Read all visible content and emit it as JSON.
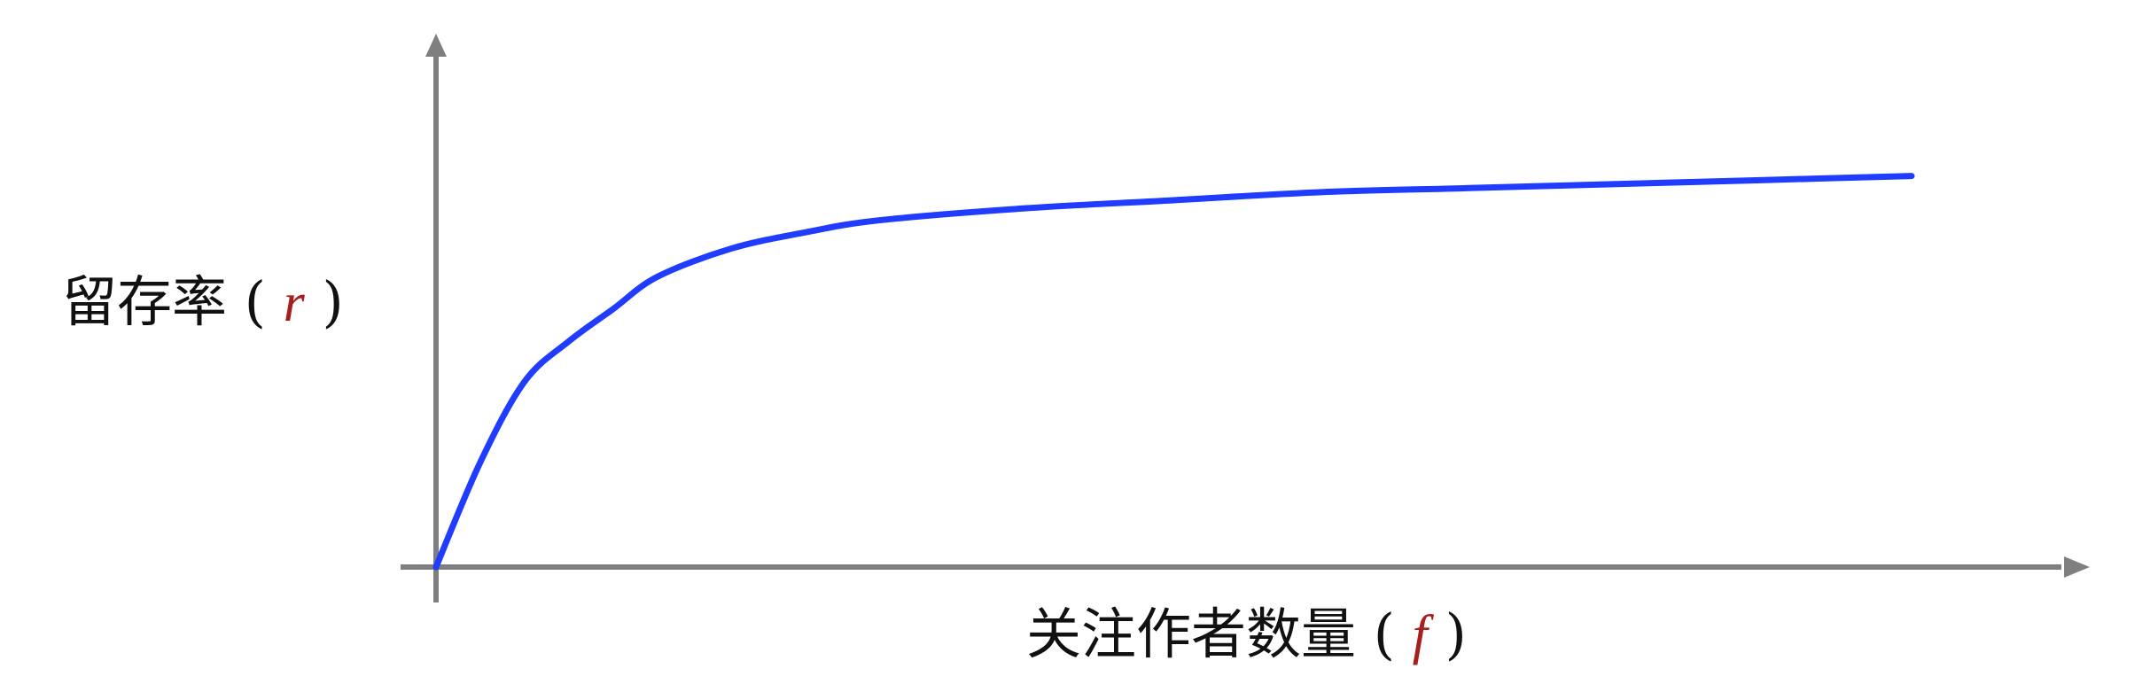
{
  "chart_data": {
    "type": "line",
    "title": "",
    "xlabel": {
      "text": "关注作者数量",
      "variable": "f"
    },
    "ylabel": {
      "text": "留存率",
      "variable": "r"
    },
    "xlim": [
      0,
      100
    ],
    "ylim": [
      0,
      100
    ],
    "grid": false,
    "series": [
      {
        "color": "#1f3cff",
        "x": [
          0,
          3,
          6,
          9,
          12,
          15,
          20,
          25,
          30,
          40,
          50,
          60,
          70,
          80,
          90,
          100
        ],
        "y": [
          0,
          26,
          46,
          56,
          64,
          72,
          79,
          83,
          86,
          89,
          91,
          93,
          94,
          95,
          96,
          97
        ]
      }
    ]
  },
  "colors": {
    "axis": "#7f7f7f",
    "curve": "#1f3cff",
    "variable": "#a61e1e",
    "label": "#111111"
  }
}
